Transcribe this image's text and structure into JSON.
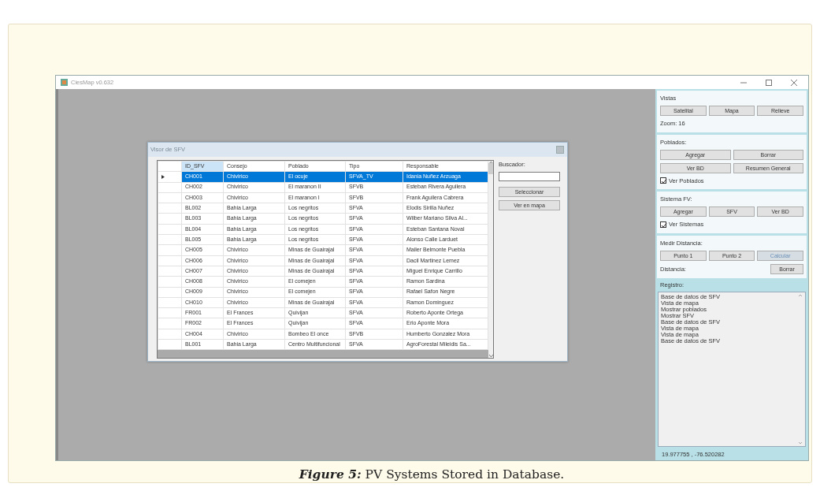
{
  "window": {
    "title": "CiesMap v0.632"
  },
  "dialog": {
    "title": "Visor de SFV",
    "search_label": "Buscador:",
    "buttons": [
      "Seleccionar",
      "Ver en mapa"
    ],
    "columns": [
      "ID_SFV",
      "Consejo",
      "Poblado",
      "Tipo",
      "Responsable"
    ],
    "rows": [
      {
        "selected": true,
        "cells": [
          "CH001",
          "Chivirico",
          "El ocuje",
          "SFVA_TV",
          "Idania Nuñez Arzuaga"
        ]
      },
      {
        "selected": false,
        "cells": [
          "CH002",
          "Chivirico",
          "El maranon II",
          "SFVB",
          "Esteban Rivera Aguilera"
        ]
      },
      {
        "selected": false,
        "cells": [
          "CH003",
          "Chivirico",
          "El maranon I",
          "SFVB",
          "Frank Aguilera Cabrera"
        ]
      },
      {
        "selected": false,
        "cells": [
          "BL002",
          "Bahia Larga",
          "Los negritos",
          "SFVA",
          "Elodis Sirilla Nuñez"
        ]
      },
      {
        "selected": false,
        "cells": [
          "BL003",
          "Bahia Larga",
          "Los negritos",
          "SFVA",
          "Wilber Mariano Silva Al..."
        ]
      },
      {
        "selected": false,
        "cells": [
          "BL004",
          "Bahia Larga",
          "Los negritos",
          "SFVA",
          "Esteban Santana Noval"
        ]
      },
      {
        "selected": false,
        "cells": [
          "BL005",
          "Bahia Larga",
          "Los negritos",
          "SFVA",
          "Alonso Calle Larduet"
        ]
      },
      {
        "selected": false,
        "cells": [
          "CH005",
          "Chivirico",
          "Minas de Guairajal",
          "SFVA",
          "Mailer Belmonte Puebla"
        ]
      },
      {
        "selected": false,
        "cells": [
          "CH006",
          "Chivirico",
          "Minas de Guairajal",
          "SFVA",
          "Dacil Martinez Lemez"
        ]
      },
      {
        "selected": false,
        "cells": [
          "CH007",
          "Chivirico",
          "Minas de Guairajal",
          "SFVA",
          "Miguel Enrique Carrillo"
        ]
      },
      {
        "selected": false,
        "cells": [
          "CH008",
          "Chivirico",
          "El comejen",
          "SFVA",
          "Ramon Sardina"
        ]
      },
      {
        "selected": false,
        "cells": [
          "CH009",
          "Chivirico",
          "El comejen",
          "SFVA",
          "Rafael Safon Negre"
        ]
      },
      {
        "selected": false,
        "cells": [
          "CH010",
          "Chivirico",
          "Minas de Guairajal",
          "SFVA",
          "Ramon Dominguez"
        ]
      },
      {
        "selected": false,
        "cells": [
          "FR001",
          "El Frances",
          "Quivijan",
          "SFVA",
          "Roberto Aponte Ortega"
        ]
      },
      {
        "selected": false,
        "cells": [
          "FR002",
          "El Frances",
          "Quivijan",
          "SFVA",
          "Erio Aponte Mora"
        ]
      },
      {
        "selected": false,
        "cells": [
          "CH004",
          "Chivirico",
          "Bombeo El once",
          "SFVB",
          "Humberto Gonzalez Mora"
        ]
      },
      {
        "selected": false,
        "cells": [
          "BL001",
          "Bahia Larga",
          "Centro Multifuncional",
          "SFVA",
          "AgroForestal Mileidis Sa..."
        ]
      }
    ]
  },
  "panel": {
    "groups": [
      {
        "title": "Vistas",
        "rows": [
          [
            {
              "label": "Satelital",
              "disabled": false
            },
            {
              "label": "Mapa",
              "disabled": false
            },
            {
              "label": "Relieve",
              "disabled": false
            }
          ]
        ],
        "note": "Zoom: 16"
      },
      {
        "title": "Poblados:",
        "rows": [
          [
            {
              "label": "Agregar",
              "disabled": false
            },
            {
              "label": "Borrar",
              "disabled": false
            }
          ],
          [
            {
              "label": "Ver BD",
              "disabled": false
            },
            {
              "label": "Resumen General",
              "disabled": false
            }
          ]
        ],
        "checkbox": {
          "label": "Ver Poblados",
          "checked": true
        }
      },
      {
        "title": "Sistema FV:",
        "rows": [
          [
            {
              "label": "Agregar",
              "disabled": false
            },
            {
              "label": "SFV",
              "disabled": false
            },
            {
              "label": "Ver BD",
              "disabled": false
            }
          ]
        ],
        "checkbox": {
          "label": "Ver Sistemas",
          "checked": true
        }
      },
      {
        "title": "Medir Distancia:",
        "rows": [
          [
            {
              "label": "Punto 1",
              "disabled": false
            },
            {
              "label": "Punto 2",
              "disabled": false
            },
            {
              "label": "Calcular",
              "disabled": true
            }
          ]
        ],
        "distance": {
          "label": "Distancia:",
          "button": "Borrar"
        }
      }
    ],
    "log_label": "Registro:",
    "log": [
      "Base de datos de SFV",
      "Vista de mapa",
      "Mostrar poblados",
      "Mostrar SFV",
      "Base de datos de SFV",
      "Vista de mapa",
      "Vista de mapa",
      "Base de datos de SFV"
    ],
    "coordinates": "19.977755 , -76.520282"
  },
  "caption": {
    "label": "Figure 5:",
    "text": "PV Systems Stored in Database."
  }
}
